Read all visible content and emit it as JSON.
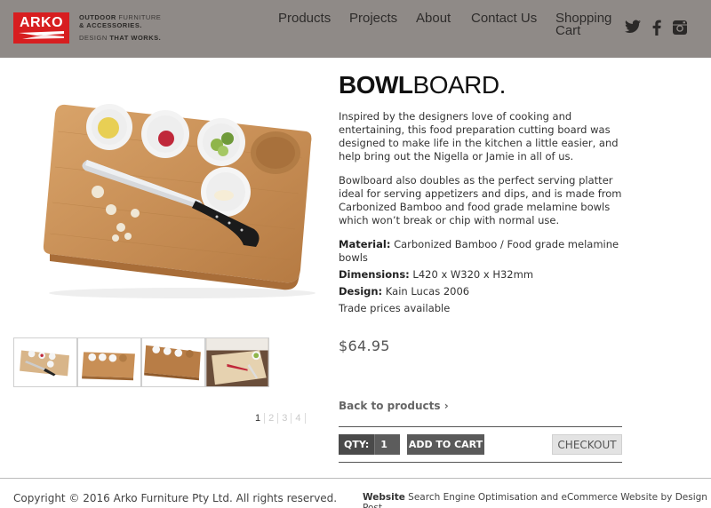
{
  "header": {
    "logo_text": "ARKO",
    "tagline": {
      "line1_bold": "OUTDOOR",
      "line1_rest": " FURNITURE",
      "line2": "& ACCESSORIES.",
      "line3_normal": "DESIGN ",
      "line3_bold": "THAT WORKS."
    },
    "nav": {
      "products": "Products",
      "projects": "Projects",
      "about": "About",
      "contact": "Contact Us",
      "cart": "Shopping Cart"
    },
    "social_icons": [
      "twitter-icon",
      "facebook-icon",
      "instagram-icon"
    ]
  },
  "product": {
    "title_bold": "BOWL",
    "title_light": "BOARD.",
    "description": [
      "Inspired by the designers love of cooking and entertaining, this food preparation cutting board was designed to make life in the kitchen a little easier, and help bring out the Nigella or Jamie in all of us.",
      "Bowlboard also doubles as the perfect serving platter ideal for serving appetizers and dips, and is made from Carbonized Bamboo and food grade melamine bowls which won’t break or chip with normal use."
    ],
    "specs": {
      "material_label": "Material:",
      "material_value": " Carbonized Bamboo / Food grade melamine bowls",
      "dimensions_label": "Dimensions:",
      "dimensions_value": " L420 x W320 x H32mm",
      "design_label": "Design:",
      "design_value": " Kain Lucas 2006",
      "trade": "Trade prices available"
    },
    "price": "$64.95",
    "back_link": "Back to products ›",
    "qty_label": "QTY:",
    "qty_value": "1",
    "add_to_cart": "ADD TO CART",
    "checkout": "CHECKOUT"
  },
  "gallery": {
    "pages": [
      "1",
      "2",
      "3",
      "4"
    ],
    "current_page": "1"
  },
  "colors": {
    "header_bg": "#8f8a87",
    "brand_red": "#d71e20",
    "bamboo": "#c8935a",
    "button_dark": "#5a5a5a"
  },
  "footer": {
    "copyright": "Copyright © 2016 Arko Furniture Pty Ltd. All rights reserved.",
    "credit_bold": "Website",
    "credit_1": " Search Engine Optimisation",
    "credit_and1": " and ",
    "credit_2": "eCommerce Website",
    "credit_by": " by ",
    "credit_3": "Design Post"
  }
}
